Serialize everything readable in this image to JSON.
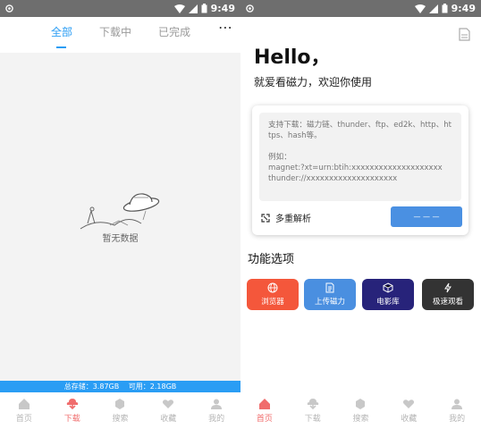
{
  "left": {
    "status_bar": {
      "time": "9:49"
    },
    "tabs": [
      {
        "label": "全部",
        "active": true
      },
      {
        "label": "下载中",
        "active": false
      },
      {
        "label": "已完成",
        "active": false
      }
    ],
    "more_label": "⋯",
    "empty_text": "暂无数据",
    "storage": {
      "total": "总存储：3.87GB",
      "available": "可用：2.18GB"
    },
    "nav": [
      {
        "label": "首页",
        "icon": "home-icon",
        "active": false
      },
      {
        "label": "下载",
        "icon": "download-icon",
        "active": true
      },
      {
        "label": "搜索",
        "icon": "search-icon",
        "active": false
      },
      {
        "label": "收藏",
        "icon": "heart-icon",
        "active": false
      },
      {
        "label": "我的",
        "icon": "user-icon",
        "active": false
      }
    ]
  },
  "right": {
    "status_bar": {
      "time": "9:49"
    },
    "hello": "Hello，",
    "welcome": "就爱看磁力，欢迎你使用",
    "input_placeholder": "支持下载：磁力链、thunder、ftp、ed2k、http、https、hash等。\n\n例如：\nmagnet:?xt=urn:btih:xxxxxxxxxxxxxxxxxxxx\nthunder://xxxxxxxxxxxxxxxxxxxx",
    "multi_parse_label": "多重解析",
    "parse_button_label": "— — —",
    "section_title": "功能选项",
    "functions": [
      {
        "label": "浏览器",
        "color": "#f4573b",
        "icon": "globe-icon"
      },
      {
        "label": "上传磁力",
        "color": "#4a8fe0",
        "icon": "upload-doc-icon"
      },
      {
        "label": "电影库",
        "color": "#27237a",
        "icon": "box-icon"
      },
      {
        "label": "极速观看",
        "color": "#333333",
        "icon": "lightning-icon"
      }
    ],
    "nav": [
      {
        "label": "首页",
        "icon": "home-icon",
        "active": true
      },
      {
        "label": "下载",
        "icon": "download-icon",
        "active": false
      },
      {
        "label": "搜索",
        "icon": "search-icon",
        "active": false
      },
      {
        "label": "收藏",
        "icon": "heart-icon",
        "active": false
      },
      {
        "label": "我的",
        "icon": "user-icon",
        "active": false
      }
    ]
  },
  "colors": {
    "accent_blue": "#2a9df4",
    "nav_active": "#f06c6c",
    "status_bar": "#6e6e6e"
  }
}
